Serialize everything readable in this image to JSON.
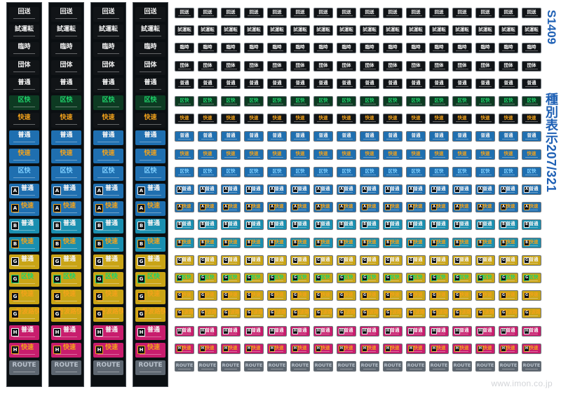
{
  "sheet": {
    "code": "S1409",
    "title": "種別表示207/321",
    "watermark": "www.imon.co.jp"
  },
  "big_column_count": 4,
  "small_column_count": 16,
  "palette": {
    "black_bg": "#0b0f12",
    "white_text": "#f2f2f2",
    "green": "#17c05a",
    "orange": "#f2a21b",
    "blue": "#2b8fd6",
    "yellow": "#e8c21c",
    "magenta": "#e0237a",
    "silver": "#8f9aa6"
  },
  "rows": [
    {
      "label": "回送",
      "text_color": "#f2f2f2",
      "bg": "#111417"
    },
    {
      "label": "試運転",
      "text_color": "#f2f2f2",
      "bg": "#111417"
    },
    {
      "label": "臨時",
      "text_color": "#f2f2f2",
      "bg": "#111417"
    },
    {
      "label": "団体",
      "text_color": "#f2f2f2",
      "bg": "#111417"
    },
    {
      "label": "普通",
      "text_color": "#f2f2f2",
      "bg": "#111417"
    },
    {
      "label": "区快",
      "text_color": "#1fd36b",
      "bg": "#0d3a22"
    },
    {
      "label": "快速",
      "text_color": "#f2a21b",
      "bg": "#111417"
    },
    {
      "label": "普通",
      "text_color": "#f2f2f2",
      "bg": "#1f6fb0"
    },
    {
      "label": "快速",
      "text_color": "#f2a21b",
      "bg": "#1f6fb0"
    },
    {
      "label": "区快",
      "text_color": "#7fd0ff",
      "bg": "#1f6fb0"
    },
    {
      "label": "A 普通",
      "text_color": "#f2f2f2",
      "bg": "#1f6fb0",
      "badge": "A"
    },
    {
      "label": "A 快速",
      "text_color": "#f2a21b",
      "bg": "#1f6fb0",
      "badge": "A"
    },
    {
      "label": "B 普通",
      "text_color": "#f2f2f2",
      "bg": "#1a8fb0",
      "badge": "B"
    },
    {
      "label": "B 快速",
      "text_color": "#f2a21b",
      "bg": "#1a8fb0",
      "badge": "B"
    },
    {
      "label": "G 普通",
      "text_color": "#f2f2f2",
      "bg": "#c9a416",
      "badge": "G"
    },
    {
      "label": "G 区快",
      "text_color": "#1fd36b",
      "bg": "#c9a416",
      "badge": "G"
    },
    {
      "label": "G 快速",
      "text_color": "#f2a21b",
      "bg": "#c9a416",
      "badge": "G"
    },
    {
      "label": "G 丹波路快速",
      "text_color": "#f2a21b",
      "bg": "#c9a416",
      "badge": "G"
    },
    {
      "label": "H 普通",
      "text_color": "#f2f2f2",
      "bg": "#c81d6d",
      "badge": "H"
    },
    {
      "label": "H 快速",
      "text_color": "#f2a21b",
      "bg": "#c81d6d",
      "badge": "H"
    },
    {
      "label": "ROUTE",
      "text_color": "#b9c2cc",
      "bg": "#5d6670"
    }
  ]
}
